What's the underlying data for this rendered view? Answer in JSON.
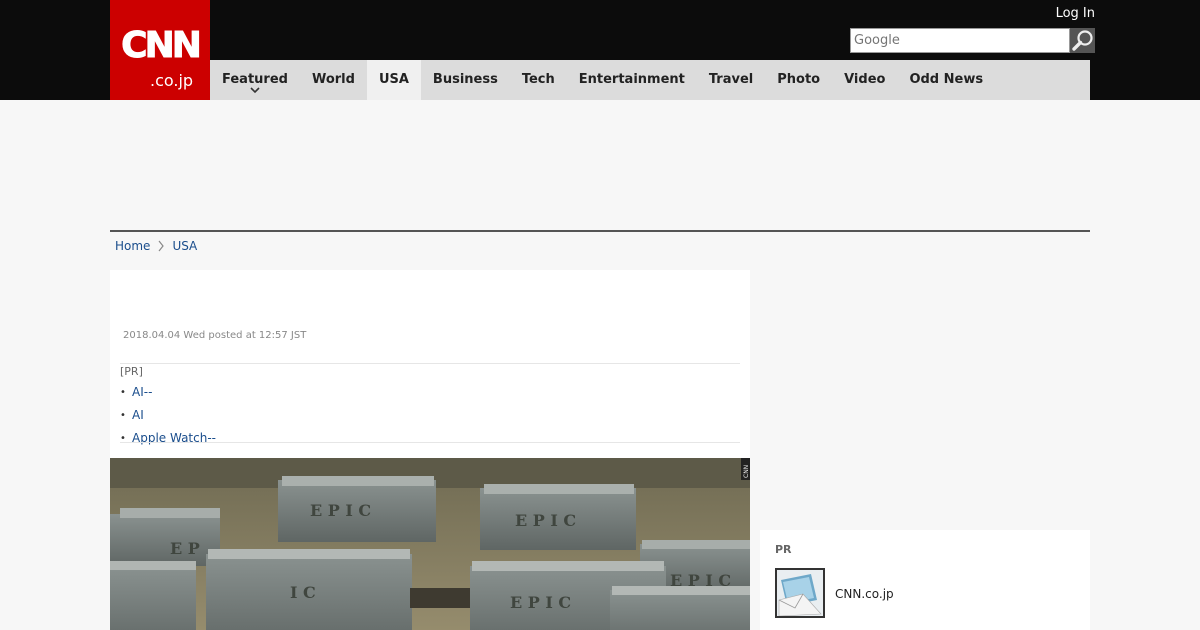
{
  "header": {
    "logo_text": "CNN",
    "logo_sub": ".co.jp",
    "login_label": "Log In",
    "search_placeholder": "Google"
  },
  "nav": {
    "items": [
      {
        "label": "Featured",
        "has_dropdown": true
      },
      {
        "label": "World"
      },
      {
        "label": "USA",
        "active": true
      },
      {
        "label": "Business"
      },
      {
        "label": "Tech"
      },
      {
        "label": "Entertainment"
      },
      {
        "label": "Travel"
      },
      {
        "label": "Photo"
      },
      {
        "label": "Video"
      },
      {
        "label": "Odd News"
      }
    ]
  },
  "breadcrumb": {
    "home": "Home",
    "current": "USA"
  },
  "article": {
    "date": "2018.04.04 Wed posted at 12:57 JST",
    "pr_label": "[PR]",
    "pr_links": [
      "AI--",
      "AI",
      "Apple Watch--"
    ],
    "photo_credit": "CNN"
  },
  "sidebar": {
    "pr_label": "PR",
    "pr_item": "CNN.co.jp"
  },
  "colors": {
    "brand_red": "#cc0000",
    "header_black": "#0c0c0c",
    "nav_gray": "#dcdcdc",
    "link_blue": "#1a4d8c"
  },
  "icons": {
    "search": "search-icon",
    "breadcrumb_separator": "chevron-right-icon",
    "dropdown": "chevron-down-icon"
  }
}
